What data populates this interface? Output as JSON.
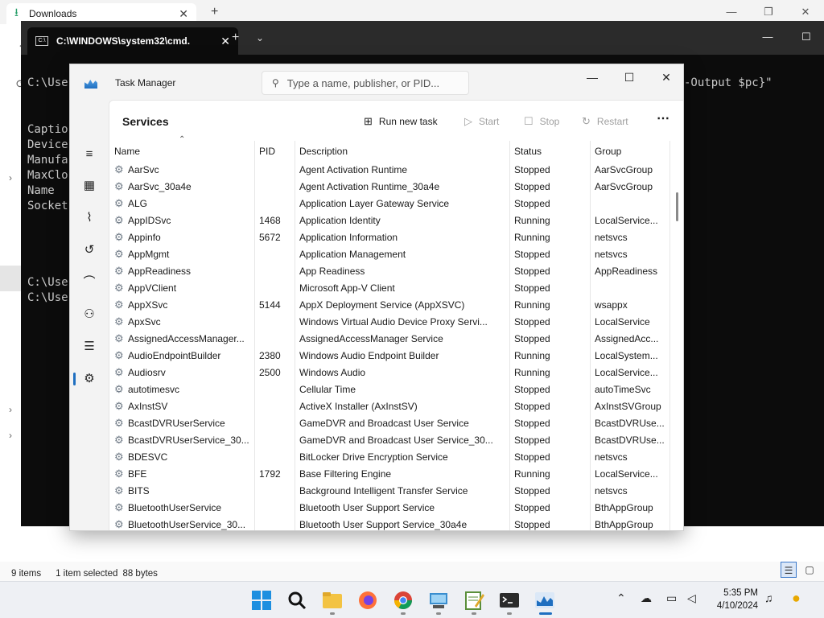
{
  "explorer": {
    "tab_title": "Downloads",
    "tab_close": "✕",
    "new_tab": "+",
    "status": {
      "items": "9 items",
      "selected": "1 item selected",
      "size": "88 bytes"
    }
  },
  "terminal": {
    "tab_title": "C:\\WINDOWS\\system32\\cmd.",
    "tab_close": "✕",
    "new_tab": "+",
    "dropdown": "⌄",
    "lines": [
      "C:\\Use",
      "",
      "Captio",
      "Device",
      "Manufa",
      "MaxClo",
      "Name",
      "Socket",
      "",
      "",
      "C:\\Use",
      "C:\\Use"
    ],
    "right_fragment": "-Output $pc}\""
  },
  "taskmgr": {
    "title": "Task Manager",
    "search_placeholder": "Type a name, publisher, or PID...",
    "page_title": "Services",
    "commands": {
      "run_new_task": "Run new task",
      "start": "Start",
      "stop": "Stop",
      "restart": "Restart",
      "more": "⋯"
    },
    "columns": [
      "Name",
      "PID",
      "Description",
      "Status",
      "Group"
    ],
    "services": [
      {
        "name": "AarSvc",
        "pid": "",
        "desc": "Agent Activation Runtime",
        "status": "Stopped",
        "group": "AarSvcGroup"
      },
      {
        "name": "AarSvc_30a4e",
        "pid": "",
        "desc": "Agent Activation Runtime_30a4e",
        "status": "Stopped",
        "group": "AarSvcGroup"
      },
      {
        "name": "ALG",
        "pid": "",
        "desc": "Application Layer Gateway Service",
        "status": "Stopped",
        "group": ""
      },
      {
        "name": "AppIDSvc",
        "pid": "1468",
        "desc": "Application Identity",
        "status": "Running",
        "group": "LocalService..."
      },
      {
        "name": "Appinfo",
        "pid": "5672",
        "desc": "Application Information",
        "status": "Running",
        "group": "netsvcs"
      },
      {
        "name": "AppMgmt",
        "pid": "",
        "desc": "Application Management",
        "status": "Stopped",
        "group": "netsvcs"
      },
      {
        "name": "AppReadiness",
        "pid": "",
        "desc": "App Readiness",
        "status": "Stopped",
        "group": "AppReadiness"
      },
      {
        "name": "AppVClient",
        "pid": "",
        "desc": "Microsoft App-V Client",
        "status": "Stopped",
        "group": ""
      },
      {
        "name": "AppXSvc",
        "pid": "5144",
        "desc": "AppX Deployment Service (AppXSVC)",
        "status": "Running",
        "group": "wsappx"
      },
      {
        "name": "ApxSvc",
        "pid": "",
        "desc": "Windows Virtual Audio Device Proxy Servi...",
        "status": "Stopped",
        "group": "LocalService"
      },
      {
        "name": "AssignedAccessManager...",
        "pid": "",
        "desc": "AssignedAccessManager Service",
        "status": "Stopped",
        "group": "AssignedAcc..."
      },
      {
        "name": "AudioEndpointBuilder",
        "pid": "2380",
        "desc": "Windows Audio Endpoint Builder",
        "status": "Running",
        "group": "LocalSystem..."
      },
      {
        "name": "Audiosrv",
        "pid": "2500",
        "desc": "Windows Audio",
        "status": "Running",
        "group": "LocalService..."
      },
      {
        "name": "autotimesvc",
        "pid": "",
        "desc": "Cellular Time",
        "status": "Stopped",
        "group": "autoTimeSvc"
      },
      {
        "name": "AxInstSV",
        "pid": "",
        "desc": "ActiveX Installer (AxInstSV)",
        "status": "Stopped",
        "group": "AxInstSVGroup"
      },
      {
        "name": "BcastDVRUserService",
        "pid": "",
        "desc": "GameDVR and Broadcast User Service",
        "status": "Stopped",
        "group": "BcastDVRUse..."
      },
      {
        "name": "BcastDVRUserService_30...",
        "pid": "",
        "desc": "GameDVR and Broadcast User Service_30...",
        "status": "Stopped",
        "group": "BcastDVRUse..."
      },
      {
        "name": "BDESVC",
        "pid": "",
        "desc": "BitLocker Drive Encryption Service",
        "status": "Stopped",
        "group": "netsvcs"
      },
      {
        "name": "BFE",
        "pid": "1792",
        "desc": "Base Filtering Engine",
        "status": "Running",
        "group": "LocalService..."
      },
      {
        "name": "BITS",
        "pid": "",
        "desc": "Background Intelligent Transfer Service",
        "status": "Stopped",
        "group": "netsvcs"
      },
      {
        "name": "BluetoothUserService",
        "pid": "",
        "desc": "Bluetooth User Support Service",
        "status": "Stopped",
        "group": "BthAppGroup"
      },
      {
        "name": "BluetoothUserService_30...",
        "pid": "",
        "desc": "Bluetooth User Support Service_30a4e",
        "status": "Stopped",
        "group": "BthAppGroup"
      }
    ]
  },
  "taskbar": {
    "time": "5:35 PM",
    "date": "4/10/2024"
  }
}
